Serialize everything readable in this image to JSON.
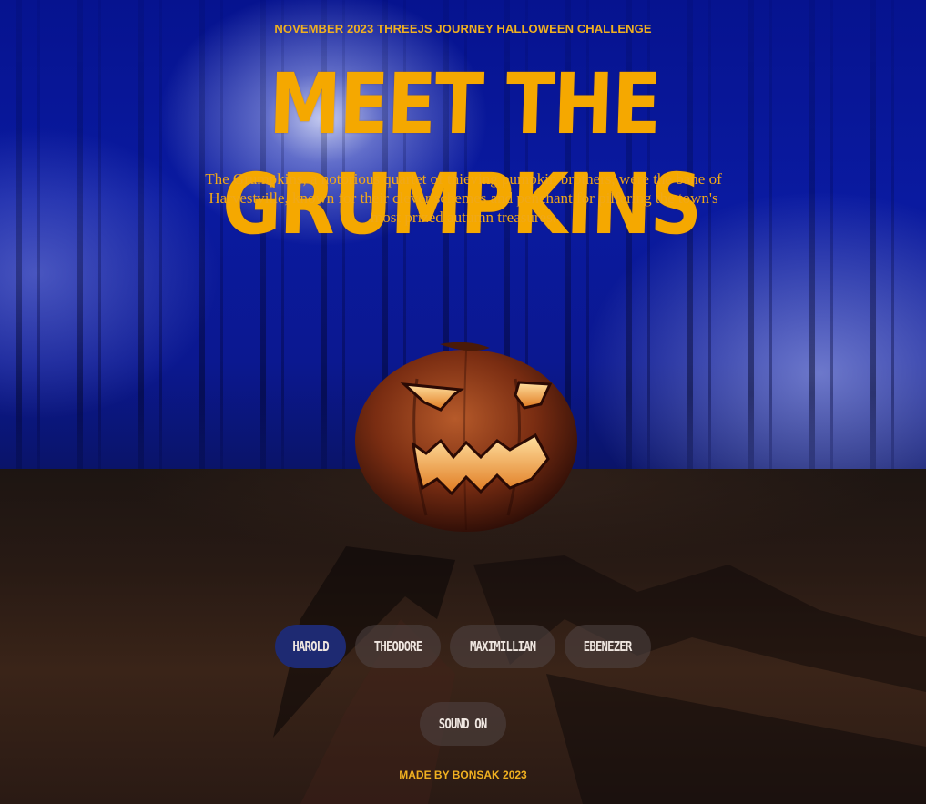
{
  "header": {
    "challenge_label": "NOVEMBER 2023 THREEJS JOURNEY HALLOWEEN CHALLENGE",
    "title": "MEET THE GRUMPKINS",
    "description": "The Grumpkins, a notorious quartet of thieving pumpkin brothers, were the bane of Harvestville, known for their clever schemes and penchant for pilfering the town's most prized autumn treasures."
  },
  "characters": [
    {
      "label": "HAROLD",
      "active": true
    },
    {
      "label": "THEODORE",
      "active": false
    },
    {
      "label": "MAXIMILLIAN",
      "active": false
    },
    {
      "label": "EBENEZER",
      "active": false
    }
  ],
  "sound_button": {
    "label": "SOUND ON"
  },
  "footer": {
    "credit": "MADE BY BONSAK 2023"
  },
  "colors": {
    "accent": "#f5a800",
    "active_button": "#1e2a72",
    "sky": "#0a1aa0"
  }
}
